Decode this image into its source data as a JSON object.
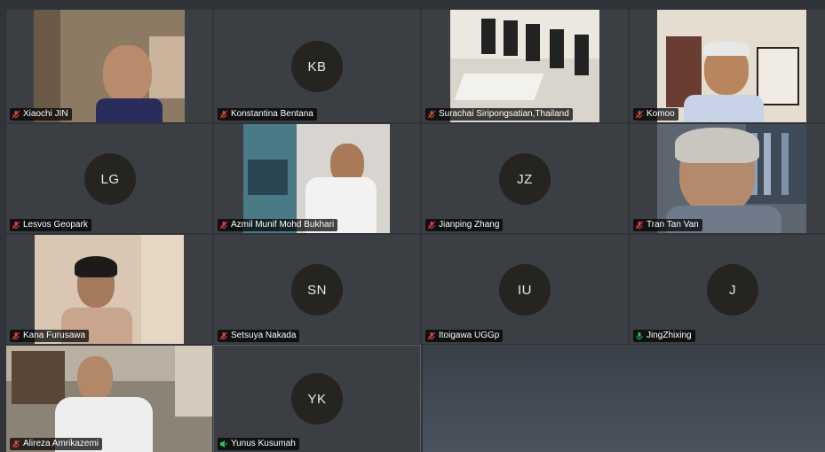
{
  "participants": [
    {
      "name": "Xiaochi JIN",
      "initials": "",
      "muted": true
    },
    {
      "name": "Konstantina Bentana",
      "initials": "KB",
      "muted": true
    },
    {
      "name": "Surachai Siripongsatian,Thailand",
      "initials": "",
      "muted": true
    },
    {
      "name": "Komoo",
      "initials": "",
      "muted": true
    },
    {
      "name": "Lesvos Geopark",
      "initials": "LG",
      "muted": true
    },
    {
      "name": "Azmil Munif Mohd Bukhari",
      "initials": "",
      "muted": true
    },
    {
      "name": "Jianping Zhang",
      "initials": "JZ",
      "muted": true
    },
    {
      "name": "Tran Tan Van",
      "initials": "",
      "muted": true
    },
    {
      "name": "Kana Furusawa",
      "initials": "",
      "muted": true
    },
    {
      "name": "Setsuya Nakada",
      "initials": "SN",
      "muted": true
    },
    {
      "name": "Itoigawa UGGp",
      "initials": "IU",
      "muted": true
    },
    {
      "name": "JingZhixing",
      "initials": "J",
      "muted": false
    },
    {
      "name": "Alireza Amrikazemi",
      "initials": "",
      "muted": true
    },
    {
      "name": "Yunus Kusumah",
      "initials": "YK",
      "muted": false,
      "speaking": true
    }
  ],
  "colors": {
    "muted_icon": "#e0433a",
    "unmuted_icon": "#2fbf5f",
    "tile_bg": "#3b3e43",
    "avatar_bg": "#262421"
  }
}
